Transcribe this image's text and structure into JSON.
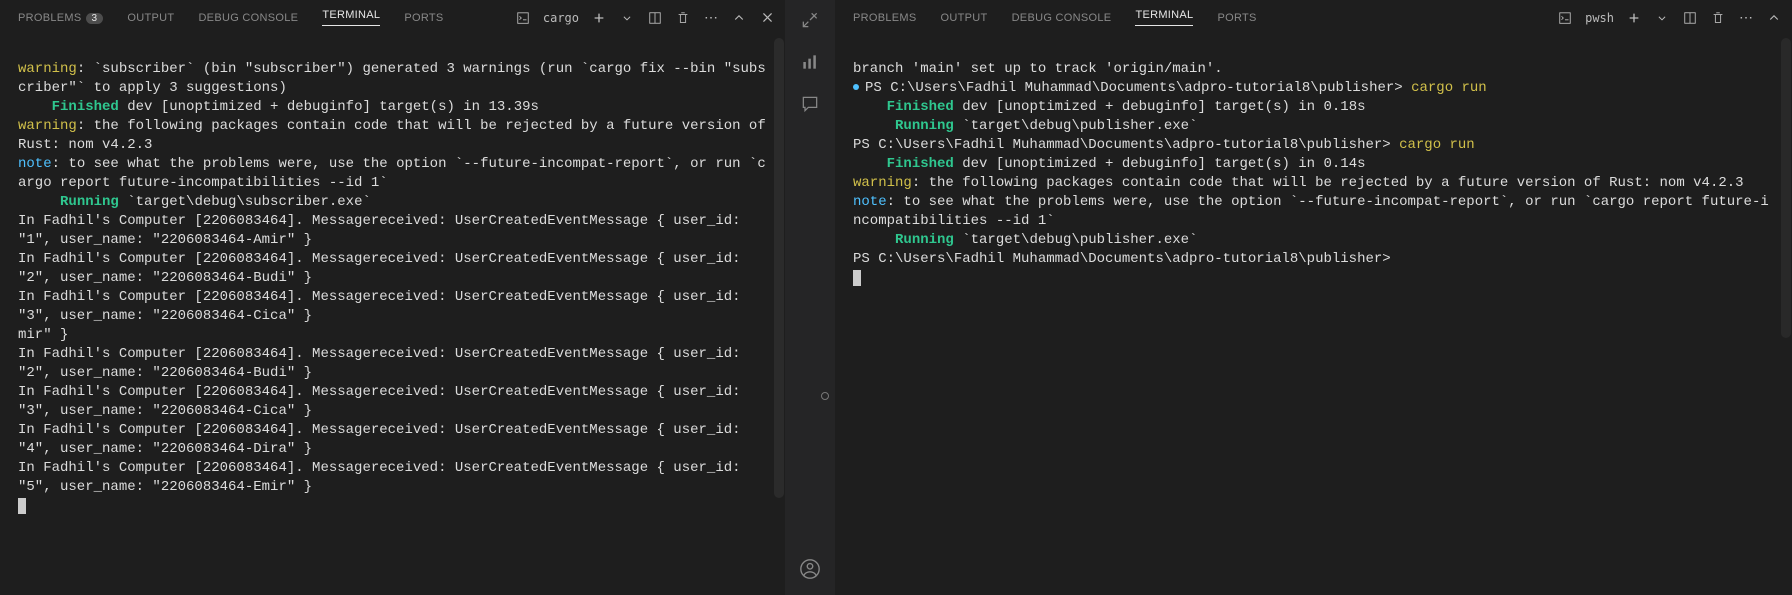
{
  "tabs": {
    "problems": "PROBLEMS",
    "problems_badge": "3",
    "output": "OUTPUT",
    "debug": "DEBUG CONSOLE",
    "terminal": "TERMINAL",
    "ports": "PORTS"
  },
  "left_toolbar": {
    "shell": "cargo"
  },
  "right_toolbar": {
    "shell": "pwsh"
  },
  "left_term": {
    "l1a": "warning",
    "l1b": ": `subscriber` (bin \"subscriber\") generated 3 warnings (run `cargo fix --bin \"subscriber\"` to apply 3 suggestions)",
    "l2a": "    Finished",
    "l2b": " dev [unoptimized + debuginfo] target(s) in 13.39s",
    "l3a": "warning",
    "l3b": ": the following packages contain code that will be rejected by a future version of Rust: nom v4.2.3",
    "l4a": "note",
    "l4b": ": to see what the problems were, use the option `--future-incompat-report`, or run `cargo report future-incompatibilities --id 1`",
    "l5a": "     Running",
    "l5b": " `target\\debug\\subscriber.exe`",
    "l6": "In Fadhil's Computer [2206083464]. Messagereceived: UserCreatedEventMessage { user_id: \"1\", user_name: \"2206083464-Amir\" }",
    "l7": "In Fadhil's Computer [2206083464]. Messagereceived: UserCreatedEventMessage { user_id: \"2\", user_name: \"2206083464-Budi\" }",
    "l8": "In Fadhil's Computer [2206083464]. Messagereceived: UserCreatedEventMessage { user_id: \"3\", user_name: \"2206083464-Cica\" }",
    "l9": "mir\" }",
    "l10": "In Fadhil's Computer [2206083464]. Messagereceived: UserCreatedEventMessage { user_id: \"2\", user_name: \"2206083464-Budi\" }",
    "l11": "In Fadhil's Computer [2206083464]. Messagereceived: UserCreatedEventMessage { user_id: \"3\", user_name: \"2206083464-Cica\" }",
    "l12": "In Fadhil's Computer [2206083464]. Messagereceived: UserCreatedEventMessage { user_id: \"4\", user_name: \"2206083464-Dira\" }",
    "l13": "In Fadhil's Computer [2206083464]. Messagereceived: UserCreatedEventMessage { user_id: \"5\", user_name: \"2206083464-Emir\" }"
  },
  "right_term": {
    "r1": "branch 'main' set up to track 'origin/main'.",
    "r2a": "PS C:\\Users\\Fadhil Muhammad\\Documents\\adpro-tutorial8\\publisher> ",
    "r2b": "cargo run",
    "r3a": "    Finished",
    "r3b": " dev [unoptimized + debuginfo] target(s) in 0.18s",
    "r4a": "     Running",
    "r4b": " `target\\debug\\publisher.exe`",
    "r5a": "PS C:\\Users\\Fadhil Muhammad\\Documents\\adpro-tutorial8\\publisher> ",
    "r5b": "cargo run",
    "r6a": "    Finished",
    "r6b": " dev [unoptimized + debuginfo] target(s) in 0.14s",
    "r7a": "warning",
    "r7b": ": the following packages contain code that will be rejected by a future version of Rust: nom v4.2.3",
    "r8a": "note",
    "r8b": ": to see what the problems were, use the option `--future-incompat-report`, or run `cargo report future-incompatibilities --id 1`",
    "r9a": "     Running",
    "r9b": " `target\\debug\\publisher.exe`",
    "r10": "PS C:\\Users\\Fadhil Muhammad\\Documents\\adpro-tutorial8\\publisher>"
  }
}
